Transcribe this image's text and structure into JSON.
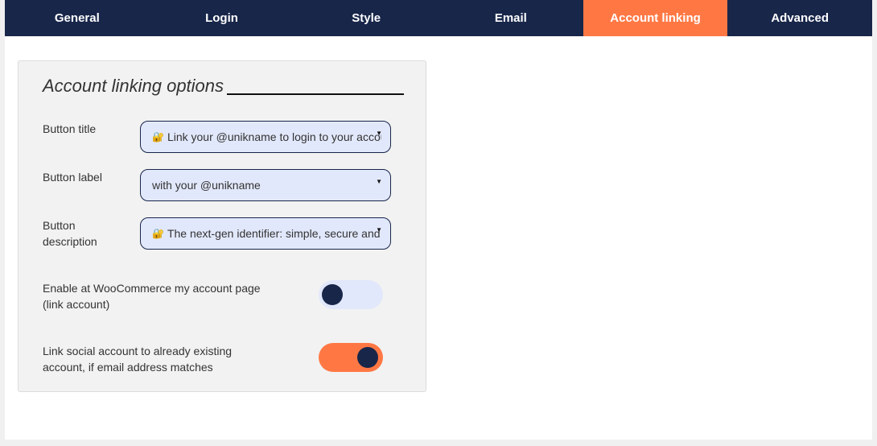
{
  "tabs": [
    "General",
    "Login",
    "Style",
    "Email",
    "Account linking",
    "Advanced"
  ],
  "active_tab": 4,
  "section_title": "Account linking options",
  "fields": [
    {
      "label": "Button title",
      "value": "Link your @unikname to login to your account",
      "icon": "lock-key-icon"
    },
    {
      "label": "Button label",
      "value": "with your @unikname"
    },
    {
      "label_line1": "Button",
      "label_line2": "description",
      "value": "The next-gen identifier: simple, secure and private",
      "icon": "lock-key-icon"
    }
  ],
  "toggles": [
    {
      "label_line1": "Enable at WooCommerce my account page",
      "label_line2": "(link account)",
      "on": false
    },
    {
      "label_line1": "Link social account to already existing",
      "label_line2": "account, if email address matches",
      "on": true
    }
  ],
  "colors": {
    "nav": "#18264a",
    "accent": "#ff7844",
    "input_bg": "#e2e8fb"
  }
}
